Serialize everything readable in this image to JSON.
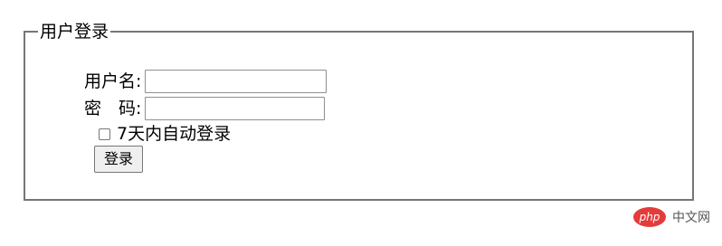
{
  "form": {
    "legend": "用户登录",
    "username_label": "用户名:",
    "username_value": "",
    "password_label": "密　码:",
    "password_value": "",
    "remember_label": "7天内自动登录",
    "remember_checked": false,
    "login_button": "登录"
  },
  "watermark": {
    "logo_text": "php",
    "site_text": "中文网"
  },
  "colors": {
    "border": "#767676",
    "button_bg": "#efefef",
    "watermark_red": "#e43b3b"
  }
}
